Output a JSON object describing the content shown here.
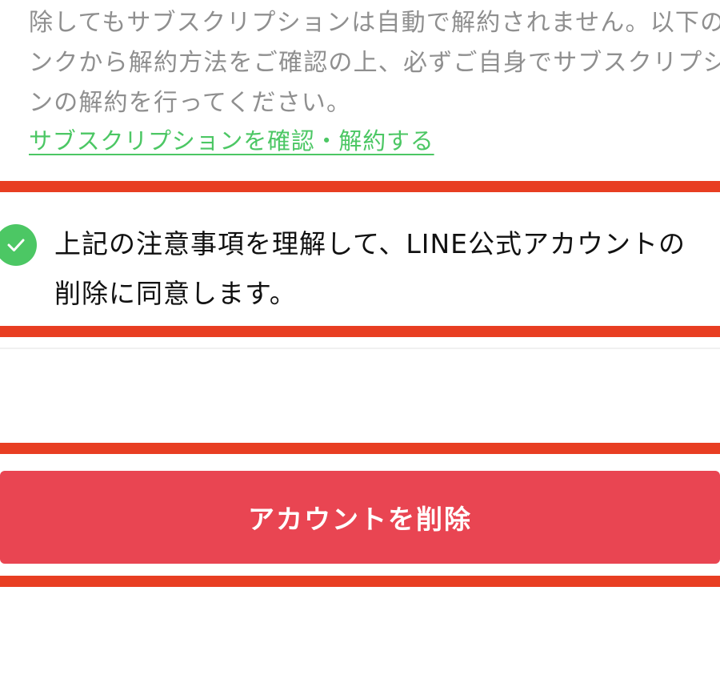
{
  "notice": {
    "text": "除してもサブスクリプションは自動で解約されません。以下のリ\nンクから解約方法をご確認の上、必ずご自身でサブスクリプショ\nンの解約を行ってください。",
    "link_label": "サブスクリプションを確認・解約する"
  },
  "consent": {
    "checked": true,
    "label": "上記の注意事項を理解して、LINE公式アカウントの\n削除に同意します。"
  },
  "actions": {
    "delete_label": "アカウントを削除"
  },
  "colors": {
    "link": "#4cc764",
    "check": "#4cc764",
    "delete_button": "#e94552",
    "highlight_line": "#e83e22",
    "notice_text": "#8f8f8f"
  },
  "icons": {
    "check": "check-circle-icon"
  }
}
